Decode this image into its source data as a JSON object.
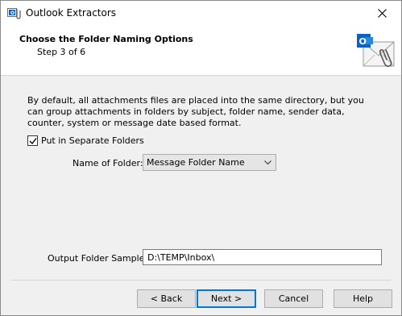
{
  "window": {
    "title": "Outlook Extractors"
  },
  "header": {
    "title": "Choose the Folder Naming Options",
    "step": "Step 3 of 6"
  },
  "body": {
    "description": "By default, all attachments files are placed into the same directory, but you can group attachments in folders by subject, folder name, sender data, counter, system or message date based format.",
    "separate_folders": {
      "label": "Put in Separate Folders",
      "checked": true
    },
    "folder_name": {
      "label": "Name of Folder:",
      "selected": "Message Folder Name"
    },
    "output_sample": {
      "label": "Output Folder Sample:",
      "value": "D:\\TEMP\\Inbox\\"
    }
  },
  "buttons": {
    "back": "< Back",
    "next": "Next >",
    "cancel": "Cancel",
    "help": "Help"
  },
  "colors": {
    "accent": "#0078d7",
    "outlook_blue": "#0a64c8"
  }
}
